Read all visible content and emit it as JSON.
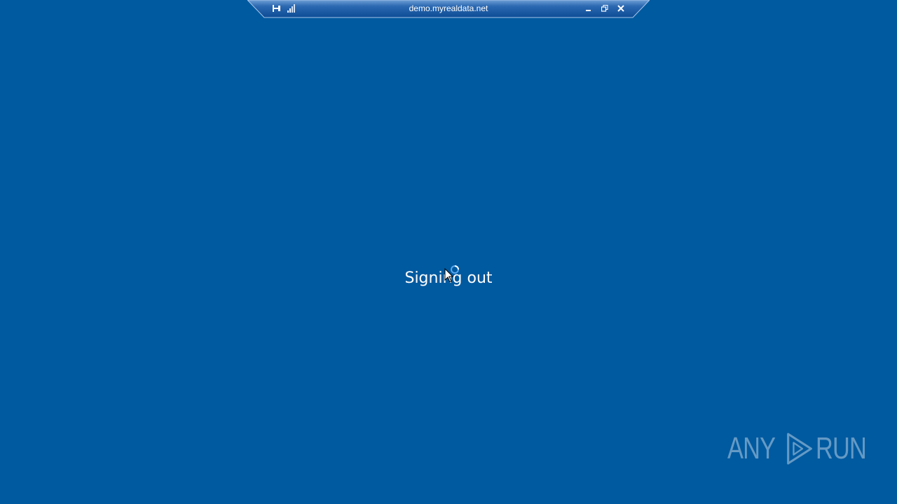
{
  "rdp_bar": {
    "title": "demo.myrealdata.net",
    "icons": {
      "pin": "pin-icon",
      "signal": "signal-strength-icon",
      "minimize": "minimize-icon",
      "restore": "restore-icon",
      "close": "close-icon"
    }
  },
  "status": {
    "text": "Signing out",
    "icons": {
      "spinner": "busy-spinner-icon",
      "cursor": "mouse-cursor-icon"
    }
  },
  "watermark": {
    "left": "ANY",
    "right": "RUN"
  },
  "colors": {
    "background": "#005aa0",
    "bar": "#1f5fa8",
    "text": "#ffffff"
  }
}
